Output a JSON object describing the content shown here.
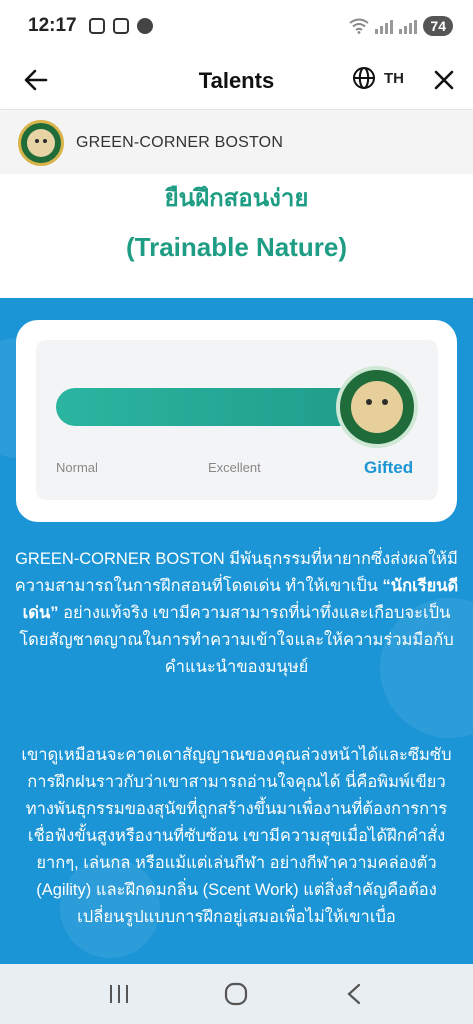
{
  "status_bar": {
    "time": "12:17",
    "battery": "74",
    "icons": [
      "instagram-icon",
      "screenshot-icon",
      "line-app-icon",
      "wifi-icon",
      "signal-icon"
    ]
  },
  "header": {
    "title": "Talents",
    "language": "TH",
    "icons": [
      "back-arrow-icon",
      "globe-icon",
      "close-icon"
    ]
  },
  "site": {
    "name": "GREEN-CORNER BOSTON"
  },
  "content": {
    "heading_thai": "ยืนฝึกสอนง่าย",
    "heading_en": "(Trainable Nature)",
    "scale": {
      "level_value": 1.0,
      "labels": [
        "Normal",
        "Excellent",
        "Gifted"
      ],
      "selected": "Gifted"
    },
    "para1": {
      "before": "GREEN-CORNER BOSTON มีพันธุกรรมที่หายากซึ่งส่งผลให้มีความสามารถในการฝึกสอนที่โดดเด่น ทำให้เขาเป็น ",
      "bold": "“นักเรียนดีเด่น”",
      "after": " อย่างแท้จริง เขามีความสามารถที่น่าทึ่งและเกือบจะเป็นโดยสัญชาตญาณในการทำความเข้าใจและให้ความร่วมมือกับคำแนะนำของมนุษย์"
    },
    "para2": "เขาดูเหมือนจะคาดเดาสัญญาณของคุณล่วงหน้าได้และซึมซับการฝึกฝนราวกับว่าเขาสามารถอ่านใจคุณได้ นี่คือพิมพ์เขียวทางพันธุกรรมของสุนัขที่ถูกสร้างขึ้นมาเพื่องานที่ต้องการการเชื่อฟังขั้นสูงหรืองานที่ซับซ้อน เขามีความสุขเมื่อได้ฝึกคำสั่งยากๆ, เล่นกล หรือแม้แต่เล่นกีฬา อย่างกีฬาความคล่องตัว (Agility) และฝึกดมกลิ่น (Scent Work) แต่สิ่งสำคัญคือต้องเปลี่ยนรูปแบบการฝึกอยู่เสมอเพื่อไม่ให้เขาเบื่อ"
  },
  "colors": {
    "accent_teal": "#1e9d84",
    "section_blue": "#1b95d6",
    "card_white": "#ffffff"
  },
  "bottom_nav": {
    "icons": [
      "recent-apps-icon",
      "home-icon",
      "back-icon"
    ]
  }
}
